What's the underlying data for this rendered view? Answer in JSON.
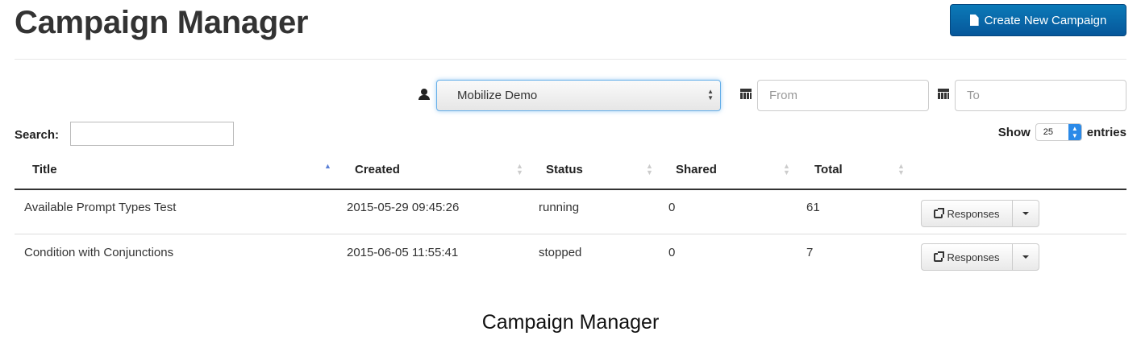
{
  "header": {
    "title": "Campaign Manager",
    "create_button_label": "Create New Campaign"
  },
  "filters": {
    "user_select_value": "Mobilize Demo",
    "from_placeholder": "From",
    "to_placeholder": "To"
  },
  "table_controls": {
    "search_label": "Search:",
    "show_label": "Show",
    "page_length": "25",
    "entries_label": "entries"
  },
  "table": {
    "columns": [
      "Title",
      "Created",
      "Status",
      "Shared",
      "Total"
    ],
    "rows": [
      {
        "title": "Available Prompt Types Test",
        "created": "2015-05-29 09:45:26",
        "status": "running",
        "shared": "0",
        "total": "61",
        "action": "Responses"
      },
      {
        "title": "Condition with Conjunctions",
        "created": "2015-06-05 11:55:41",
        "status": "stopped",
        "shared": "0",
        "total": "7",
        "action": "Responses"
      }
    ]
  },
  "caption": "Campaign Manager",
  "colors": {
    "primary_button": "#06579a",
    "focus_border": "#66afe9",
    "sort_active": "#5a7fd6"
  }
}
